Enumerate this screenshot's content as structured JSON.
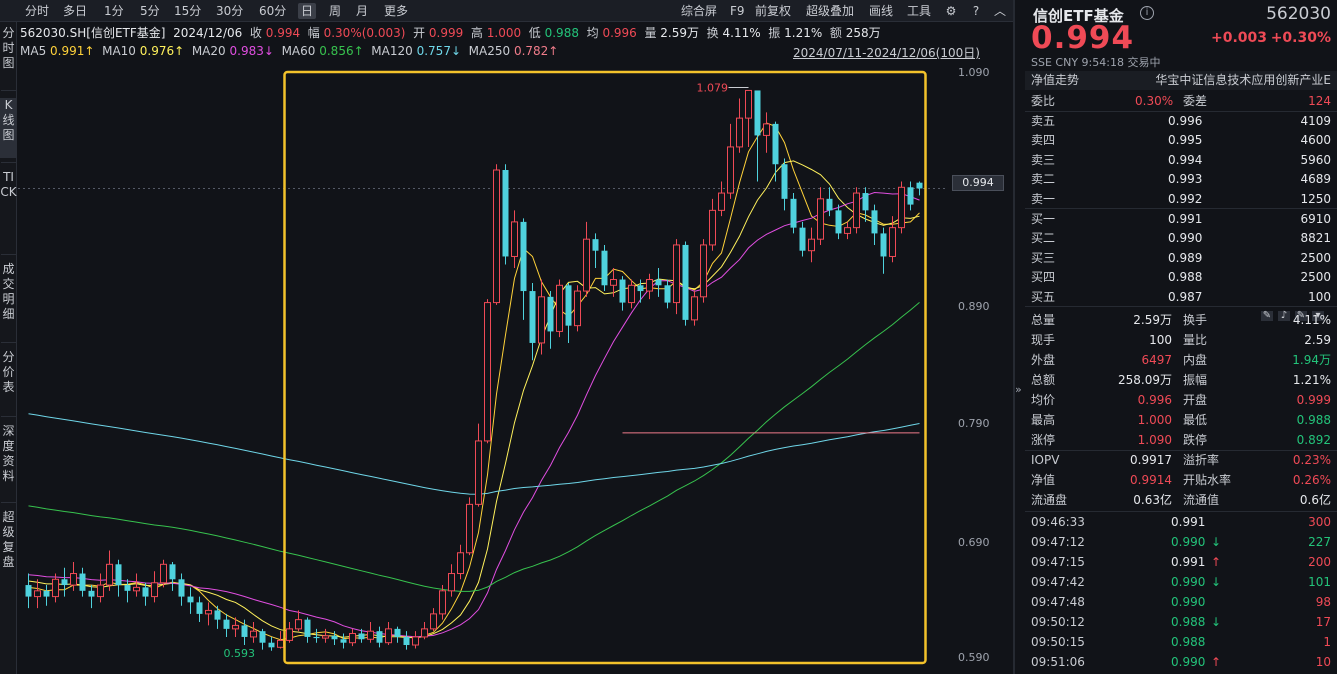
{
  "toolbar": {
    "periods": [
      "分时",
      "多日",
      "1分",
      "5分",
      "15分",
      "30分",
      "60分",
      "日",
      "周",
      "月",
      "更多"
    ],
    "active_period": "日",
    "tools": [
      "综合屏",
      "F9",
      "前复权",
      "超级叠加",
      "画线",
      "工具"
    ]
  },
  "left_nav": [
    "分时图",
    "K线图",
    "TICK",
    "成交明细",
    "分价表",
    "深度资料",
    "超级复盘"
  ],
  "info": {
    "code_name": "562030.SH[信创ETF基金]",
    "date": "2024/12/06",
    "close_label": "收",
    "close": "0.994",
    "amp_label": "幅",
    "amp": "0.30%(0.003)",
    "open_label": "开",
    "open": "0.999",
    "high_label": "高",
    "high": "1.000",
    "low_label": "低",
    "low": "0.988",
    "avg_label": "均",
    "avg": "0.996",
    "vol_label": "量",
    "vol": "2.59万",
    "turn_label": "换",
    "turn": "4.11%",
    "swing_label": "振",
    "swing": "1.21%",
    "amt_label": "额",
    "amt": "258万"
  },
  "ma": [
    {
      "name": "MA5",
      "value": "0.991↑"
    },
    {
      "name": "MA10",
      "value": "0.976↑"
    },
    {
      "name": "MA20",
      "value": "0.983↓"
    },
    {
      "name": "MA60",
      "value": "0.856↑"
    },
    {
      "name": "MA120",
      "value": "0.757↓"
    },
    {
      "name": "MA250",
      "value": "0.782↑"
    }
  ],
  "date_range": "2024/07/11-2024/12/06(100日)",
  "y_axis": [
    "1.090",
    "0.890",
    "0.790",
    "0.690",
    "0.590"
  ],
  "current_price_tag": "0.994",
  "annotations": {
    "high": "1.079",
    "low": "0.593"
  },
  "chart_data": {
    "type": "candlestick",
    "y_range": [
      0.585,
      1.095
    ],
    "candles": [
      [
        0.65,
        0.64,
        0.66,
        0.63
      ],
      [
        0.64,
        0.645,
        0.655,
        0.63
      ],
      [
        0.645,
        0.64,
        0.65,
        0.632
      ],
      [
        0.64,
        0.655,
        0.66,
        0.635
      ],
      [
        0.655,
        0.65,
        0.665,
        0.64
      ],
      [
        0.65,
        0.66,
        0.67,
        0.645
      ],
      [
        0.66,
        0.645,
        0.665,
        0.64
      ],
      [
        0.645,
        0.64,
        0.65,
        0.63
      ],
      [
        0.64,
        0.65,
        0.66,
        0.635
      ],
      [
        0.65,
        0.668,
        0.68,
        0.645
      ],
      [
        0.668,
        0.65,
        0.672,
        0.64
      ],
      [
        0.65,
        0.645,
        0.655,
        0.635
      ],
      [
        0.645,
        0.648,
        0.66,
        0.64
      ],
      [
        0.648,
        0.64,
        0.652,
        0.632
      ],
      [
        0.64,
        0.652,
        0.662,
        0.635
      ],
      [
        0.652,
        0.668,
        0.672,
        0.648
      ],
      [
        0.668,
        0.655,
        0.67,
        0.645
      ],
      [
        0.655,
        0.64,
        0.66,
        0.632
      ],
      [
        0.64,
        0.635,
        0.648,
        0.625
      ],
      [
        0.635,
        0.625,
        0.64,
        0.618
      ],
      [
        0.625,
        0.628,
        0.635,
        0.615
      ],
      [
        0.628,
        0.62,
        0.632,
        0.612
      ],
      [
        0.62,
        0.612,
        0.625,
        0.605
      ],
      [
        0.612,
        0.615,
        0.622,
        0.605
      ],
      [
        0.615,
        0.605,
        0.62,
        0.598
      ],
      [
        0.605,
        0.61,
        0.618,
        0.6
      ],
      [
        0.61,
        0.6,
        0.612,
        0.594
      ],
      [
        0.6,
        0.596,
        0.605,
        0.593
      ],
      [
        0.596,
        0.602,
        0.61,
        0.595
      ],
      [
        0.602,
        0.612,
        0.618,
        0.6
      ],
      [
        0.612,
        0.62,
        0.628,
        0.61
      ],
      [
        0.62,
        0.605,
        0.622,
        0.6
      ],
      [
        0.605,
        0.604,
        0.612,
        0.6
      ],
      [
        0.604,
        0.606,
        0.612,
        0.6
      ],
      [
        0.606,
        0.603,
        0.61,
        0.598
      ],
      [
        0.603,
        0.6,
        0.608,
        0.595
      ],
      [
        0.6,
        0.608,
        0.612,
        0.597
      ],
      [
        0.608,
        0.603,
        0.612,
        0.6
      ],
      [
        0.603,
        0.61,
        0.618,
        0.6
      ],
      [
        0.61,
        0.6,
        0.614,
        0.596
      ],
      [
        0.6,
        0.612,
        0.618,
        0.598
      ],
      [
        0.612,
        0.605,
        0.614,
        0.6
      ],
      [
        0.605,
        0.598,
        0.61,
        0.594
      ],
      [
        0.598,
        0.605,
        0.61,
        0.595
      ],
      [
        0.605,
        0.612,
        0.618,
        0.603
      ],
      [
        0.612,
        0.625,
        0.63,
        0.61
      ],
      [
        0.625,
        0.645,
        0.65,
        0.62
      ],
      [
        0.645,
        0.66,
        0.668,
        0.64
      ],
      [
        0.66,
        0.678,
        0.685,
        0.655
      ],
      [
        0.678,
        0.72,
        0.726,
        0.676
      ],
      [
        0.72,
        0.775,
        0.79,
        0.718
      ],
      [
        0.775,
        0.895,
        0.898,
        0.773
      ],
      [
        0.895,
        1.01,
        1.015,
        0.893
      ],
      [
        1.01,
        0.935,
        1.015,
        0.928
      ],
      [
        0.935,
        0.965,
        0.975,
        0.925
      ],
      [
        0.965,
        0.905,
        0.968,
        0.88
      ],
      [
        0.905,
        0.86,
        0.912,
        0.845
      ],
      [
        0.86,
        0.9,
        0.915,
        0.85
      ],
      [
        0.9,
        0.87,
        0.905,
        0.855
      ],
      [
        0.87,
        0.91,
        0.915,
        0.865
      ],
      [
        0.91,
        0.875,
        0.912,
        0.86
      ],
      [
        0.875,
        0.905,
        0.91,
        0.87
      ],
      [
        0.905,
        0.95,
        0.965,
        0.9
      ],
      [
        0.95,
        0.94,
        0.955,
        0.925
      ],
      [
        0.94,
        0.91,
        0.945,
        0.905
      ],
      [
        0.91,
        0.915,
        0.925,
        0.9
      ],
      [
        0.915,
        0.895,
        0.918,
        0.888
      ],
      [
        0.895,
        0.91,
        0.915,
        0.89
      ],
      [
        0.91,
        0.905,
        0.915,
        0.895
      ],
      [
        0.905,
        0.915,
        0.92,
        0.898
      ],
      [
        0.915,
        0.91,
        0.925,
        0.9
      ],
      [
        0.91,
        0.895,
        0.915,
        0.89
      ],
      [
        0.895,
        0.945,
        0.95,
        0.885
      ],
      [
        0.945,
        0.88,
        0.948,
        0.875
      ],
      [
        0.88,
        0.9,
        0.905,
        0.875
      ],
      [
        0.9,
        0.945,
        0.95,
        0.895
      ],
      [
        0.945,
        0.975,
        0.985,
        0.94
      ],
      [
        0.975,
        0.99,
        1.0,
        0.97
      ],
      [
        0.99,
        1.03,
        1.05,
        0.985
      ],
      [
        1.03,
        1.055,
        1.072,
        1.025
      ],
      [
        1.055,
        1.079,
        1.079,
        1.03
      ],
      [
        1.079,
        1.04,
        1.079,
        1.0
      ],
      [
        1.04,
        1.05,
        1.06,
        1.025
      ],
      [
        1.05,
        1.015,
        1.052,
        1.0
      ],
      [
        1.015,
        0.985,
        1.02,
        0.975
      ],
      [
        0.985,
        0.96,
        0.99,
        0.955
      ],
      [
        0.96,
        0.94,
        0.965,
        0.935
      ],
      [
        0.94,
        0.95,
        0.96,
        0.93
      ],
      [
        0.95,
        0.985,
        0.995,
        0.945
      ],
      [
        0.985,
        0.975,
        0.995,
        0.97
      ],
      [
        0.975,
        0.955,
        0.98,
        0.95
      ],
      [
        0.955,
        0.96,
        0.965,
        0.95
      ],
      [
        0.96,
        0.99,
        0.995,
        0.955
      ],
      [
        0.99,
        0.975,
        0.995,
        0.965
      ],
      [
        0.975,
        0.955,
        0.98,
        0.945
      ],
      [
        0.955,
        0.935,
        0.96,
        0.92
      ],
      [
        0.935,
        0.96,
        0.97,
        0.93
      ],
      [
        0.96,
        0.995,
        1.0,
        0.955
      ],
      [
        0.995,
        0.98,
        1.0,
        0.975
      ],
      [
        0.999,
        0.994,
        1.0,
        0.988
      ]
    ],
    "ma_lines": {
      "MA5": {
        "color": "#ffd23a"
      },
      "MA10": {
        "color": "#fff15c"
      },
      "MA20": {
        "color": "#e04ee0"
      },
      "MA60": {
        "color": "#37c24e"
      },
      "MA120": {
        "color": "#6fd6e8"
      },
      "MA250": {
        "color": "#f07c8a"
      }
    },
    "highlight_box": {
      "from_index": 29,
      "to_index": 99,
      "color": "#f3c22b"
    }
  },
  "right_panel": {
    "title": "信创ETF基金",
    "code": "562030",
    "price": "0.994",
    "change": "+0.003",
    "change_pct": "+0.30%",
    "exchange": "SSE   CNY   9:54:18   交易中",
    "nav_label": "净值走势",
    "nav_desc": "华宝中证信息技术应用创新产业E",
    "weibi_label": "委比",
    "weibi": "0.30%",
    "weicha_label": "委差",
    "weicha": "124",
    "asks": [
      {
        "label": "卖五",
        "price": "0.996",
        "vol": "4109"
      },
      {
        "label": "卖四",
        "price": "0.995",
        "vol": "4600"
      },
      {
        "label": "卖三",
        "price": "0.994",
        "vol": "5960"
      },
      {
        "label": "卖二",
        "price": "0.993",
        "vol": "4689"
      },
      {
        "label": "卖一",
        "price": "0.992",
        "vol": "1250"
      }
    ],
    "bids": [
      {
        "label": "买一",
        "price": "0.991",
        "vol": "6910"
      },
      {
        "label": "买二",
        "price": "0.990",
        "vol": "8821"
      },
      {
        "label": "买三",
        "price": "0.989",
        "vol": "2500"
      },
      {
        "label": "买四",
        "price": "0.988",
        "vol": "2500"
      },
      {
        "label": "买五",
        "price": "0.987",
        "vol": "100"
      }
    ],
    "stats": [
      {
        "l1": "总量",
        "v1": "2.59万",
        "c1": "white",
        "l2": "换手",
        "v2": "4.11%",
        "c2": "white"
      },
      {
        "l1": "现手",
        "v1": "100",
        "c1": "white",
        "l2": "量比",
        "v2": "2.59",
        "c2": "white"
      },
      {
        "l1": "外盘",
        "v1": "6497",
        "c1": "red",
        "l2": "内盘",
        "v2": "1.94万",
        "c2": "green"
      },
      {
        "l1": "总额",
        "v1": "258.09万",
        "c1": "white",
        "l2": "振幅",
        "v2": "1.21%",
        "c2": "white"
      },
      {
        "l1": "均价",
        "v1": "0.996",
        "c1": "red",
        "l2": "开盘",
        "v2": "0.999",
        "c2": "red"
      },
      {
        "l1": "最高",
        "v1": "1.000",
        "c1": "red",
        "l2": "最低",
        "v2": "0.988",
        "c2": "green"
      },
      {
        "l1": "涨停",
        "v1": "1.090",
        "c1": "red",
        "l2": "跌停",
        "v2": "0.892",
        "c2": "green"
      }
    ],
    "stats2": [
      {
        "l1": "IOPV",
        "v1": "0.9917",
        "c1": "white",
        "l2": "溢折率",
        "v2": "0.23%",
        "c2": "red"
      },
      {
        "l1": "净值",
        "v1": "0.9914",
        "c1": "red",
        "l2": "开贴水率",
        "v2": "0.26%",
        "c2": "red"
      },
      {
        "l1": "流通盘",
        "v1": "0.63亿",
        "c1": "white",
        "l2": "流通值",
        "v2": "0.6亿",
        "c2": "white"
      }
    ],
    "ticks": [
      {
        "time": "09:46:33",
        "price": "0.991",
        "pc": "white",
        "arrow": "",
        "vol": "300",
        "vc": "red"
      },
      {
        "time": "09:47:12",
        "price": "0.990",
        "pc": "green",
        "arrow": "↓",
        "vol": "227",
        "vc": "green"
      },
      {
        "time": "09:47:15",
        "price": "0.991",
        "pc": "white",
        "arrow": "↑",
        "vol": "200",
        "vc": "red"
      },
      {
        "time": "09:47:42",
        "price": "0.990",
        "pc": "green",
        "arrow": "↓",
        "vol": "101",
        "vc": "green"
      },
      {
        "time": "09:47:48",
        "price": "0.990",
        "pc": "green",
        "arrow": "",
        "vol": "98",
        "vc": "red"
      },
      {
        "time": "09:50:12",
        "price": "0.988",
        "pc": "green",
        "arrow": "↓",
        "vol": "17",
        "vc": "red"
      },
      {
        "time": "09:50:15",
        "price": "0.988",
        "pc": "green",
        "arrow": "",
        "vol": "1",
        "vc": "red"
      },
      {
        "time": "09:51:06",
        "price": "0.990",
        "pc": "green",
        "arrow": "↑",
        "vol": "10",
        "vc": "red"
      }
    ]
  }
}
